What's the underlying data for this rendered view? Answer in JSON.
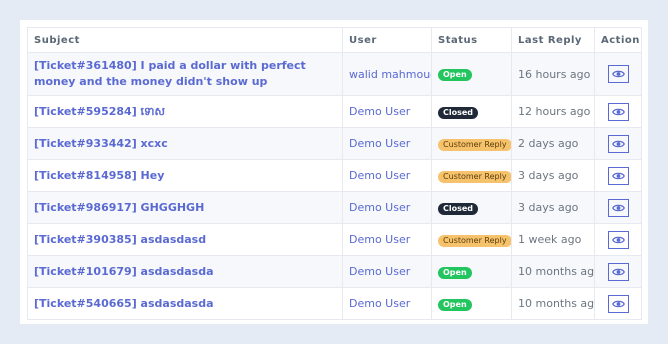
{
  "table": {
    "headers": [
      "Subject",
      "User",
      "Status",
      "Last Reply",
      "Action"
    ],
    "rows": [
      {
        "subject": "[Ticket#361480] I paid a dollar with perfect money and the money didn't show up",
        "user": "walid mahmoud",
        "status": "Open",
        "status_type": "open",
        "last_reply": "16 hours ago",
        "action_icon": "eye-icon"
      },
      {
        "subject": "[Ticket#595284] ទោស",
        "user": "Demo User",
        "status": "Closed",
        "status_type": "closed",
        "last_reply": "12 hours ago",
        "action_icon": "eye-icon"
      },
      {
        "subject": "[Ticket#933442] xcxc",
        "user": "Demo User",
        "status": "Customer Reply",
        "status_type": "customer",
        "last_reply": "2 days ago",
        "action_icon": "eye-icon"
      },
      {
        "subject": "[Ticket#814958] Hey",
        "user": "Demo User",
        "status": "Customer Reply",
        "status_type": "customer",
        "last_reply": "3 days ago",
        "action_icon": "eye-icon"
      },
      {
        "subject": "[Ticket#986917] GHGGHGH",
        "user": "Demo User",
        "status": "Closed",
        "status_type": "closed",
        "last_reply": "3 days ago",
        "action_icon": "eye-icon"
      },
      {
        "subject": "[Ticket#390385] asdasdasd",
        "user": "Demo User",
        "status": "Customer Reply",
        "status_type": "customer",
        "last_reply": "1 week ago",
        "action_icon": "eye-icon"
      },
      {
        "subject": "[Ticket#101679] asdasdasda",
        "user": "Demo User",
        "status": "Open",
        "status_type": "open",
        "last_reply": "10 months ago",
        "action_icon": "eye-icon"
      },
      {
        "subject": "[Ticket#540665] asdasdasda",
        "user": "Demo User",
        "status": "Open",
        "status_type": "open",
        "last_reply": "10 months ago",
        "action_icon": "eye-icon"
      }
    ]
  },
  "colors": {
    "background": "#e4ebf5",
    "link": "#5a6ad2",
    "open": "#22c55e",
    "closed": "#1f2937",
    "customer_reply": "#f6c26b"
  }
}
